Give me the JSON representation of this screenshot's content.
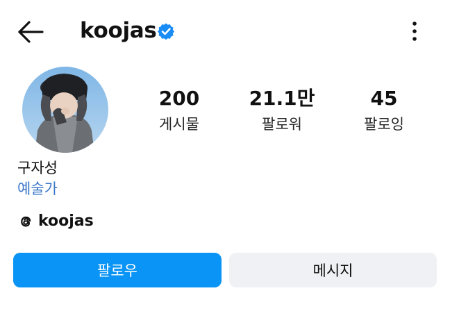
{
  "header": {
    "back_icon": "arrow-left-icon",
    "username": "koojas",
    "verified_icon": "verified-badge-icon",
    "more_icon": "more-vertical-icon"
  },
  "profile": {
    "avatar_icon": "profile-avatar",
    "stats": [
      {
        "value": "200",
        "label": "게시물"
      },
      {
        "value": "21.1만",
        "label": "팔로워"
      },
      {
        "value": "45",
        "label": "팔로잉"
      }
    ],
    "full_name": "구자성",
    "category": "예술가",
    "threads": {
      "icon": "threads-icon",
      "handle": "koojas"
    }
  },
  "actions": {
    "follow_label": "팔로우",
    "message_label": "메시지"
  },
  "colors": {
    "accent": "#0a95f6",
    "category_text": "#3a77c9",
    "verified": "#1a8cf5",
    "secondary_button": "#eff1f4"
  }
}
